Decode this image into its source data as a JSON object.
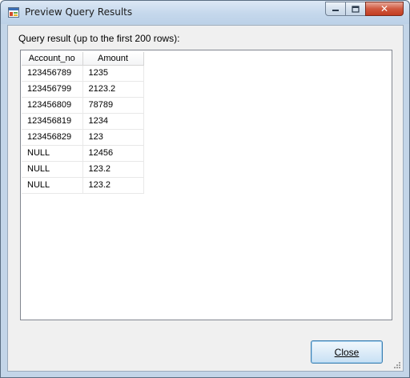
{
  "window": {
    "title": "Preview Query Results",
    "caption_close": "✕"
  },
  "main": {
    "label": "Query result (up to the first 200 rows):"
  },
  "grid": {
    "columns": [
      "Account_no",
      "Amount"
    ],
    "rows": [
      [
        "123456789",
        "1235"
      ],
      [
        "123456799",
        "2123.2"
      ],
      [
        "123456809",
        "78789"
      ],
      [
        "123456819",
        "1234"
      ],
      [
        "123456829",
        "123"
      ],
      [
        "NULL",
        "12456"
      ],
      [
        "NULL",
        "123.2"
      ],
      [
        "NULL",
        "123.2"
      ]
    ]
  },
  "footer": {
    "close_label": "Close"
  },
  "colors": {
    "accent": "#3c7fb1",
    "close_red": "#c33d22"
  },
  "icons": [
    "app-icon",
    "minimize-icon",
    "maximize-icon",
    "close-icon",
    "resize-grip-icon"
  ]
}
